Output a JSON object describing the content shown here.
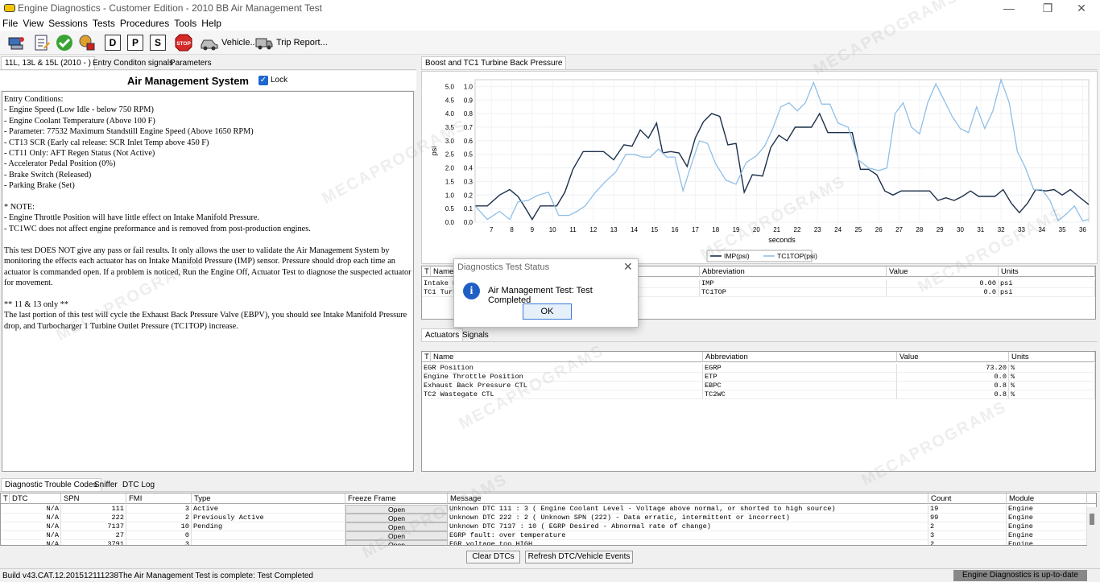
{
  "window": {
    "title": "Engine Diagnostics - Customer Edition - 2010 BB Air Management Test",
    "controls": {
      "minimize": "—",
      "maximize": "❐",
      "close": "✕"
    }
  },
  "menu": [
    "File",
    "View",
    "Sessions",
    "Tests",
    "Procedures",
    "Tools",
    "Help"
  ],
  "toolbar": {
    "letters": [
      "D",
      "P",
      "S"
    ],
    "stop_label": "STOP",
    "vehicle_label": "Vehicle...",
    "trip_report_label": "Trip Report..."
  },
  "left_panel": {
    "tabs": [
      "11L, 13L & 15L (2010 - )",
      "Entry Conditon signals",
      "Parameters"
    ],
    "heading": "Air Management System",
    "checkbox_mark": "✓",
    "lock_label": "Lock",
    "conditions_text": "Entry Conditions:\n- Engine Speed (Low Idle - below 750 RPM)\n- Engine Coolant Temperature (Above 100 F)\n- Parameter: 77532 Maximum Standstill Engine Speed (Above 1650 RPM)\n- CT13 SCR (Early cal release: SCR Inlet Temp above 450 F)\n- CT11 Only: AFT Regen Status (Not Active)\n- Accelerator Pedal Position (0%)\n- Brake Switch (Released)\n- Parking Brake (Set)\n\n* NOTE:\n- Engine Throttle Position will have little effect on Intake Manifold Pressure.\n- TC1WC does not affect engine preformance and is removed from post-production engines.\n\nThis test DOES NOT give any pass or fail results. It only allows the user to validate the Air Management System by\nmonitoring the effects each actuator has on Intake Manifold Pressure (IMP) sensor. Pressure should drop each time an\nactuator is commanded open. If a problem is noticed, Run the Engine Off, Actuator Test to diagnose the suspected actuator\nfor movement.\n\n** 11 & 13 only **\nThe last portion of this test will cycle the Exhaust Back Pressure Valve (EBPV), you should see Intake Manifold Pressure\ndrop, and Turbocharger 1 Turbine Outlet Pressure (TC1TOP) increase."
  },
  "chart_panel": {
    "tab": "Boost and TC1 Turbine Back Pressure"
  },
  "chart_data": {
    "type": "line",
    "xlabel": "seconds",
    "ylabel": "psi",
    "x_ticks": [
      7,
      8,
      9,
      10,
      11,
      12,
      13,
      14,
      15,
      16,
      17,
      18,
      19,
      20,
      21,
      22,
      23,
      24,
      25,
      26,
      27,
      28,
      29,
      30,
      31,
      32,
      33,
      34,
      35,
      36
    ],
    "xlim": [
      6.2,
      36.3
    ],
    "y_left_ticks": [
      "0.0",
      "0.5",
      "1.0",
      "1.5",
      "2.0",
      "2.5",
      "3.0",
      "3.5",
      "4.0",
      "4.5",
      "5.0"
    ],
    "y_right_ticks": [
      "0.0",
      "0.1",
      "0.2",
      "0.3",
      "0.4",
      "0.5",
      "0.6",
      "0.7",
      "0.8",
      "0.9",
      "1.0"
    ],
    "ylim": [
      0,
      1.05
    ],
    "legend_position": "bottom-center",
    "series": [
      {
        "name": "IMP(psi)",
        "color": "#1c2f4a",
        "x": [
          6.2,
          6.8,
          7.4,
          7.9,
          8.3,
          8.6,
          9.0,
          9.4,
          9.8,
          10.2,
          10.6,
          11.0,
          11.5,
          12.0,
          12.5,
          13.0,
          13.5,
          13.9,
          14.3,
          14.7,
          15.1,
          15.4,
          15.8,
          16.2,
          16.6,
          17.0,
          17.4,
          17.8,
          18.2,
          18.6,
          19.0,
          19.4,
          19.8,
          20.3,
          20.7,
          21.1,
          21.5,
          21.9,
          22.3,
          22.7,
          23.1,
          23.5,
          23.9,
          24.3,
          24.7,
          25.1,
          25.5,
          25.9,
          26.3,
          26.7,
          27.1,
          27.5,
          28.0,
          28.5,
          28.9,
          29.3,
          29.7,
          30.1,
          30.5,
          30.9,
          31.3,
          31.7,
          32.1,
          32.5,
          32.9,
          33.3,
          33.7,
          34.2,
          34.6,
          35.0,
          35.4,
          35.8,
          36.3
        ],
        "y": [
          0.12,
          0.12,
          0.2,
          0.24,
          0.19,
          0.12,
          0.02,
          0.12,
          0.12,
          0.12,
          0.22,
          0.39,
          0.52,
          0.52,
          0.52,
          0.46,
          0.57,
          0.56,
          0.68,
          0.62,
          0.73,
          0.51,
          0.52,
          0.51,
          0.41,
          0.62,
          0.74,
          0.8,
          0.78,
          0.57,
          0.58,
          0.22,
          0.35,
          0.34,
          0.55,
          0.64,
          0.6,
          0.7,
          0.7,
          0.7,
          0.8,
          0.66,
          0.66,
          0.66,
          0.66,
          0.39,
          0.39,
          0.35,
          0.23,
          0.2,
          0.23,
          0.23,
          0.23,
          0.23,
          0.16,
          0.18,
          0.16,
          0.19,
          0.23,
          0.19,
          0.19,
          0.19,
          0.24,
          0.14,
          0.07,
          0.14,
          0.24,
          0.23,
          0.24,
          0.2,
          0.24,
          0.19,
          0.13
        ]
      },
      {
        "name": "TC1TOP(psi)",
        "color": "#8fbfe6",
        "x": [
          6.2,
          6.8,
          7.4,
          7.9,
          8.3,
          8.8,
          9.3,
          9.8,
          10.3,
          10.8,
          11.2,
          11.6,
          12.1,
          12.6,
          13.1,
          13.6,
          14.0,
          14.4,
          14.8,
          15.2,
          15.6,
          16.0,
          16.4,
          16.8,
          17.2,
          17.6,
          18.0,
          18.5,
          19.0,
          19.5,
          20.0,
          20.4,
          20.8,
          21.2,
          21.6,
          22.0,
          22.4,
          22.8,
          23.2,
          23.6,
          24.0,
          24.5,
          25.0,
          25.5,
          26.0,
          26.4,
          26.8,
          27.2,
          27.6,
          28.0,
          28.4,
          28.8,
          29.2,
          29.6,
          30.0,
          30.4,
          30.8,
          31.2,
          31.6,
          32.0,
          32.4,
          32.8,
          33.2,
          33.6,
          34.0,
          34.4,
          34.8,
          35.2,
          35.6,
          36.0,
          36.3
        ],
        "y": [
          0.12,
          0.02,
          0.08,
          0.02,
          0.15,
          0.16,
          0.2,
          0.22,
          0.05,
          0.05,
          0.08,
          0.12,
          0.22,
          0.3,
          0.37,
          0.5,
          0.5,
          0.48,
          0.48,
          0.54,
          0.48,
          0.48,
          0.23,
          0.42,
          0.6,
          0.58,
          0.43,
          0.31,
          0.28,
          0.44,
          0.49,
          0.56,
          0.69,
          0.85,
          0.88,
          0.82,
          0.88,
          1.03,
          0.87,
          0.87,
          0.73,
          0.7,
          0.46,
          0.4,
          0.38,
          0.4,
          0.8,
          0.88,
          0.7,
          0.65,
          0.88,
          1.02,
          0.9,
          0.78,
          0.69,
          0.66,
          0.85,
          0.69,
          0.82,
          1.05,
          0.88,
          0.52,
          0.4,
          0.24,
          0.24,
          0.16,
          0.01,
          0.06,
          0.12,
          0.01,
          0.02
        ]
      }
    ]
  },
  "signals_table": {
    "columns": [
      "Name",
      "Abbreviation",
      "Value",
      "Units"
    ],
    "rows": [
      {
        "name": "Intake M",
        "abbr": "IMP",
        "value": "0.00",
        "units": "psi"
      },
      {
        "name": "TC1 Turb",
        "abbr": "TC1TOP",
        "value": "0.0",
        "units": "psi"
      }
    ]
  },
  "actuators_panel": {
    "tabs": [
      "Actuators",
      "Signals"
    ],
    "columns": [
      "Name",
      "Abbreviation",
      "Value",
      "Units"
    ],
    "rows": [
      {
        "name": "EGR Position",
        "abbr": "EGRP",
        "value": "73.20",
        "units": "%"
      },
      {
        "name": "Engine Throttle Position",
        "abbr": "ETP",
        "value": "0.0",
        "units": "%"
      },
      {
        "name": "Exhaust Back Pressure CTL",
        "abbr": "EBPC",
        "value": "0.8",
        "units": "%"
      },
      {
        "name": "TC2 Wastegate CTL",
        "abbr": "TC2WC",
        "value": "0.8",
        "units": "%"
      }
    ]
  },
  "bottom_panel": {
    "tabs": [
      "Diagnostic Trouble Codes",
      "Sniffer",
      "DTC Log"
    ],
    "columns": [
      "DTC",
      "SPN",
      "FMI",
      "Type",
      "Freeze Frame",
      "Message",
      "Count",
      "Module"
    ],
    "rows": [
      {
        "dtc": "N/A",
        "spn": "111",
        "fmi": "3",
        "type": "Active",
        "freeze": "Open",
        "message": "Unknown DTC 111 : 3  ( Engine Coolant Level - Voltage above normal, or shorted to high source)",
        "count": "19",
        "module": "Engine"
      },
      {
        "dtc": "N/A",
        "spn": "222",
        "fmi": "2",
        "type": "Previously Active",
        "freeze": "Open",
        "message": "Unknown DTC 222 : 2  ( Unknown SPN (222) - Data erratic, intermittent or incorrect)",
        "count": "99",
        "module": "Engine"
      },
      {
        "dtc": "N/A",
        "spn": "7137",
        "fmi": "10",
        "type": "Pending",
        "freeze": "Open",
        "message": "Unknown DTC 7137 : 10  ( EGRP Desired - Abnormal rate of change)",
        "count": "2",
        "module": "Engine"
      },
      {
        "dtc": "N/A",
        "spn": "27",
        "fmi": "0",
        "type": "",
        "freeze": "Open",
        "message": "EGRP fault: over temperature",
        "count": "3",
        "module": "Engine"
      },
      {
        "dtc": "N/A",
        "spn": "3791",
        "fmi": "3",
        "type": "",
        "freeze": "Open",
        "message": "EGR voltage too HIGH",
        "count": "2",
        "module": "Engine"
      }
    ],
    "clear_label": "Clear DTCs",
    "refresh_label": "Refresh DTC/Vehicle Events"
  },
  "status_bar": {
    "build": "Build v43.CAT.12.201512111238",
    "message": "The Air Management Test is complete: Test Completed",
    "status": "Engine Diagnostics is up-to-date"
  },
  "dialog": {
    "title": "Diagnostics Test Status",
    "close": "✕",
    "icon": "i",
    "message": "Air Management Test: Test Completed",
    "ok_label": "OK"
  },
  "watermark_text": "MECAPROGRAMS"
}
